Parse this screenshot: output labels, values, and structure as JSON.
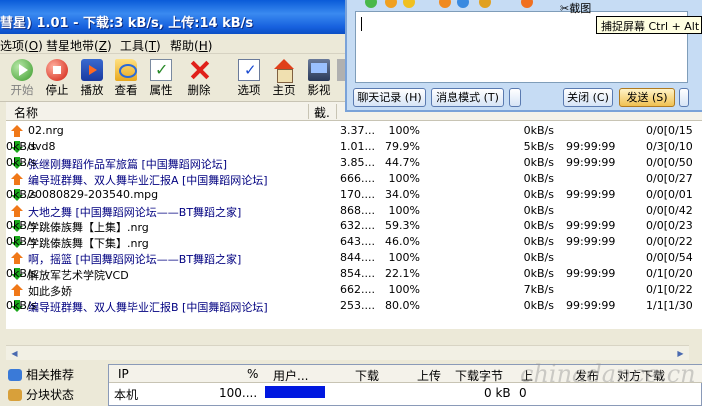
{
  "window": {
    "title": "彗星) 1.01 - 下载:3 kB/s, 上传:14 kB/s"
  },
  "menu": [
    "选项",
    "彗星地带",
    "工具",
    "帮助"
  ],
  "toolbar": [
    {
      "label": "开始",
      "icon": "play-icon",
      "enabled": false
    },
    {
      "label": "停止",
      "icon": "stop-icon",
      "enabled": true
    },
    {
      "label": "播放",
      "icon": "film-play-icon",
      "enabled": true
    },
    {
      "label": "查看",
      "icon": "folder-search-icon",
      "enabled": true
    },
    {
      "label": "属性",
      "icon": "properties-icon",
      "enabled": true
    },
    {
      "label": "删除",
      "icon": "delete-icon",
      "enabled": true
    },
    {
      "label": "选项",
      "icon": "options-icon",
      "enabled": true
    },
    {
      "label": "主页",
      "icon": "home-icon",
      "enabled": true
    },
    {
      "label": "影视",
      "icon": "video-icon",
      "enabled": true
    }
  ],
  "list": {
    "headers": {
      "name": "名称",
      "size": "截."
    },
    "rows": [
      {
        "dir": "up",
        "name": "02.nrg",
        "size": "3.37...",
        "pct": "100%",
        "down": "",
        "up": "0kB/s",
        "eta": "",
        "peers": "0/0[0/15"
      },
      {
        "dir": "down",
        "name": "dvd8",
        "size": "1.01...",
        "pct": "79.9%",
        "down": "0kB/s",
        "up": "5kB/s",
        "eta": "99:99:99",
        "peers": "0/3[0/10"
      },
      {
        "dir": "down",
        "name": "张继刚舞蹈作品军旅篇 [中国舞蹈网论坛]",
        "size": "3.85...",
        "pct": "44.7%",
        "down": "0kB/s",
        "up": "0kB/s",
        "eta": "99:99:99",
        "peers": "0/0[0/50"
      },
      {
        "dir": "up",
        "name": "编导班群舞、双人舞毕业汇报A [中国舞蹈网论坛]",
        "size": "666....",
        "pct": "100%",
        "down": "",
        "up": "0kB/s",
        "eta": "",
        "peers": "0/0[0/27"
      },
      {
        "dir": "down",
        "name": "20080829-203540.mpg",
        "size": "170....",
        "pct": "34.0%",
        "down": "0kB/s",
        "up": "0kB/s",
        "eta": "99:99:99",
        "peers": "0/0[0/01"
      },
      {
        "dir": "up",
        "name": "大地之舞 [中国舞蹈网论坛——BT舞蹈之家]",
        "size": "868....",
        "pct": "100%",
        "down": "",
        "up": "0kB/s",
        "eta": "",
        "peers": "0/0[0/42"
      },
      {
        "dir": "down",
        "name": "学跳傣族舞【上集】.nrg",
        "size": "632....",
        "pct": "59.3%",
        "down": "0kB/s",
        "up": "0kB/s",
        "eta": "99:99:99",
        "peers": "0/0[0/23"
      },
      {
        "dir": "down",
        "name": "学跳傣族舞【下集】.nrg",
        "size": "643....",
        "pct": "46.0%",
        "down": "0kB/s",
        "up": "0kB/s",
        "eta": "99:99:99",
        "peers": "0/0[0/22"
      },
      {
        "dir": "up",
        "name": "啊，摇篮 [中国舞蹈网论坛——BT舞蹈之家]",
        "size": "844....",
        "pct": "100%",
        "down": "",
        "up": "0kB/s",
        "eta": "",
        "peers": "0/0[0/54"
      },
      {
        "dir": "down",
        "name": "解放军艺术学院VCD",
        "size": "854....",
        "pct": "22.1%",
        "down": "0kB/s",
        "up": "0kB/s",
        "eta": "99:99:99",
        "peers": "0/1[0/20"
      },
      {
        "dir": "up",
        "name": "如此多娇",
        "size": "662....",
        "pct": "100%",
        "down": "",
        "up": "7kB/s",
        "eta": "",
        "peers": "0/1[0/22"
      },
      {
        "dir": "down",
        "name": "编导班群舞、双人舞毕业汇报B [中国舞蹈网论坛]",
        "size": "253....",
        "pct": "80.0%",
        "down": "0kB/s",
        "up": "0kB/s",
        "eta": "99:99:99",
        "peers": "1/1[1/30"
      }
    ]
  },
  "sidepanel": {
    "items": [
      "相关推荐",
      "分块状态"
    ]
  },
  "peers": {
    "headers": [
      "IP",
      "%",
      "用户...",
      "下载",
      "上传",
      "下载字节",
      "上",
      "发布",
      "对方下载"
    ],
    "row": {
      "ip": "本机",
      "pct": "100....",
      "bytes": "0 kB",
      "mark": "0"
    }
  },
  "chat": {
    "buttons": {
      "history": "聊天记录 (H)",
      "mode": "消息模式 (T)",
      "close": "关闭 (C)",
      "send": "发送 (S)"
    },
    "screenshot_label": "截图",
    "tooltip": "捕捉屏幕 Ctrl + Alt +"
  },
  "watermark": "chinadance.cn"
}
